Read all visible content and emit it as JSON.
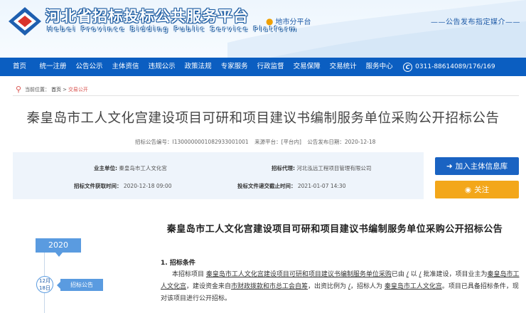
{
  "header": {
    "title": "河北省招标投标公共服务平台",
    "subtitle": "Hebei Province Bidding Public Service Platform",
    "region_link": "地市分平台",
    "media_text": "——公告发布指定媒介——"
  },
  "nav": {
    "items": [
      "首页",
      "统一注册",
      "公告公示",
      "主体资信",
      "违规公示",
      "政策法规",
      "专家服务",
      "行政监督",
      "交易保障",
      "交易统计",
      "服务中心"
    ],
    "phone": "0311-88614089/176/169"
  },
  "breadcrumb": {
    "prefix": "当前位置：",
    "home": "首页",
    "separator": " > ",
    "current": "交易公开"
  },
  "notice": {
    "title": "秦皇岛市工人文化宫建设项目可研和项目建议书编制服务单位采购公开招标公告",
    "meta": {
      "code": "招标公告编号：I1300000001082933001001",
      "source": "来源平台：[平台内]",
      "date": "公告发布日期：2020-12-18"
    }
  },
  "info": {
    "owner_label": "业主单位:",
    "owner_value": "秦皇岛市工人文化宫",
    "agent_label": "招标代理:",
    "agent_value": "河北泓远工程项目管理有限公司",
    "time_label": "招标文件获取时间：",
    "time_value": "2020-12-18 09:00",
    "deadline_label": "投标文件递交截止时间：",
    "deadline_value": "2021-01-07 14:30"
  },
  "actions": {
    "add_label": "加入主体信息库",
    "follow_label": "关注"
  },
  "timeline": {
    "year": "2020",
    "date_line1": "12月",
    "date_line2": "18日",
    "tag": "招标公告"
  },
  "document": {
    "title": "秦皇岛市工人文化宫建设项目可研和项目建议书编制服务单位采购公开招标公告",
    "section1": "1. 招标条件",
    "p1_a": "本招标项目 ",
    "p1_project": "秦皇岛市工人文化宫建设项目可研和项目建议书编制服务单位采购",
    "p1_b": "已由 ",
    "p1_c": "/",
    "p1_d": " 以 ",
    "p1_e": "/",
    "p1_f": " 批准建设，项目业主为",
    "p1_owner": "秦皇岛市工人文化宫",
    "p1_g": "，建设资金来自",
    "p1_fund": "市财政拨款和市总工会自筹",
    "p1_h": "，出资比例为 ",
    "p1_i": "/",
    "p1_j": "，招标人为 ",
    "p1_tenderer": "秦皇岛市工人文化宫",
    "p1_k": "。项目已具备招标条件，现对该项目进行公开招标。"
  }
}
